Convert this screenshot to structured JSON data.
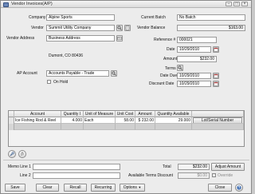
{
  "window": {
    "title": "Vendor Invoices(A/P)"
  },
  "left": {
    "company_label": "Company",
    "company_value": "Alpine Sports",
    "vendor_label": "Vendor",
    "vendor_value": "Summit Utility Company",
    "vendor_address_label": "Vendor Address",
    "vendor_address_value": "Business Address",
    "address_line": "Dumont, CO  80436",
    "ap_account_label": "AP Account",
    "ap_account_value": "Accounts Payable - Trade",
    "on_hold_label": "On Hold"
  },
  "right": {
    "current_batch_label": "Current Batch",
    "current_batch_value": "No Batch",
    "vendor_balance_label": "Vendor Balance",
    "vendor_balance_value": "$163.00",
    "reference_label": "Reference #",
    "reference_value": "000021",
    "date_label": "Date",
    "date_value": "10/29/2010",
    "amount_label": "Amount",
    "amount_value": "$232.00",
    "terms_label": "Terms",
    "date_due_label": "Date Due",
    "date_due_value": "10/29/2010",
    "discount_date_label": "Discount Date",
    "discount_date_value": "10/29/2010"
  },
  "grid": {
    "columns": [
      "Account",
      "Quantity I",
      "Unit of Measure",
      "Unit Cost",
      "Amount",
      "Quantity Available",
      ""
    ],
    "rows": [
      [
        "Ice Fishing Rod & Reel",
        "4.000",
        "Each",
        "58.00",
        "$ 232.00",
        "29.000",
        "Lot/Serial Number"
      ]
    ]
  },
  "footer": {
    "memo_line1_label": "Memo Line 1",
    "memo_line2_label": "Line 2",
    "total_label": "Total",
    "total_value": "$232.00",
    "adjust_amount_label": "Adjust Amount",
    "available_terms_discount_label": "Available Terms Discount",
    "available_terms_discount_value": "$0.00",
    "override_label": "Override"
  },
  "buttons": {
    "save": "Save",
    "clear": "Clear",
    "recall": "Recall",
    "recurring": "Recurring",
    "options": "Options",
    "close": "Close"
  }
}
